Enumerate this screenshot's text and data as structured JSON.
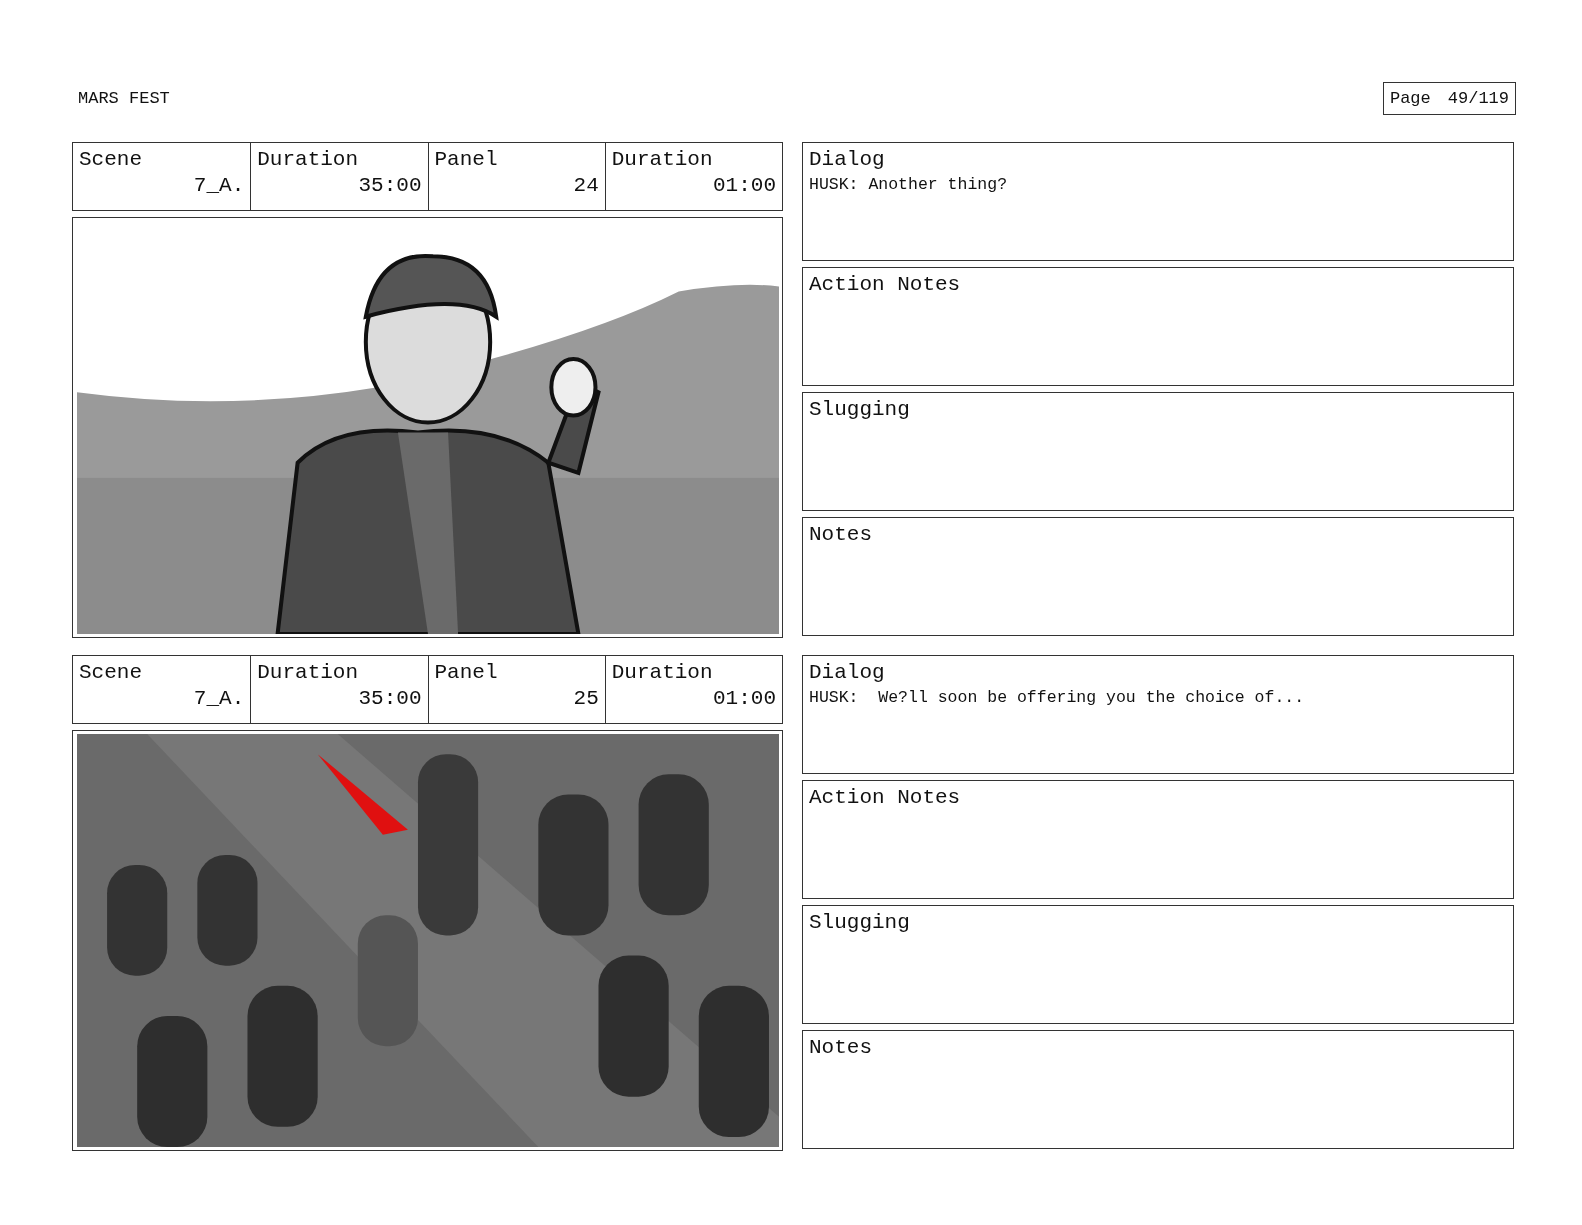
{
  "header": {
    "title": "MARS FEST",
    "page_label": "Page",
    "page_number": "49/119"
  },
  "panels": [
    {
      "info_table": {
        "columns": [
          "Scene",
          "Duration",
          "Panel",
          "Duration"
        ],
        "row": [
          "7_A.",
          "35:00",
          "24",
          "01:00"
        ]
      },
      "notes": [
        {
          "label": "Dialog",
          "text": "HUSK: Another thing?"
        },
        {
          "label": "Action Notes"
        },
        {
          "label": "Slugging"
        },
        {
          "label": "Notes"
        }
      ]
    },
    {
      "info_table": {
        "columns": [
          "Scene",
          "Duration",
          "Panel",
          "Duration"
        ],
        "row": [
          "7_A.",
          "35:00",
          "25",
          "01:00"
        ]
      },
      "notes": [
        {
          "label": "Dialog",
          "text": "HUSK:  We?ll soon be offering you the choice of..."
        },
        {
          "label": "Action Notes"
        },
        {
          "label": "Slugging"
        },
        {
          "label": "Notes"
        }
      ]
    }
  ]
}
